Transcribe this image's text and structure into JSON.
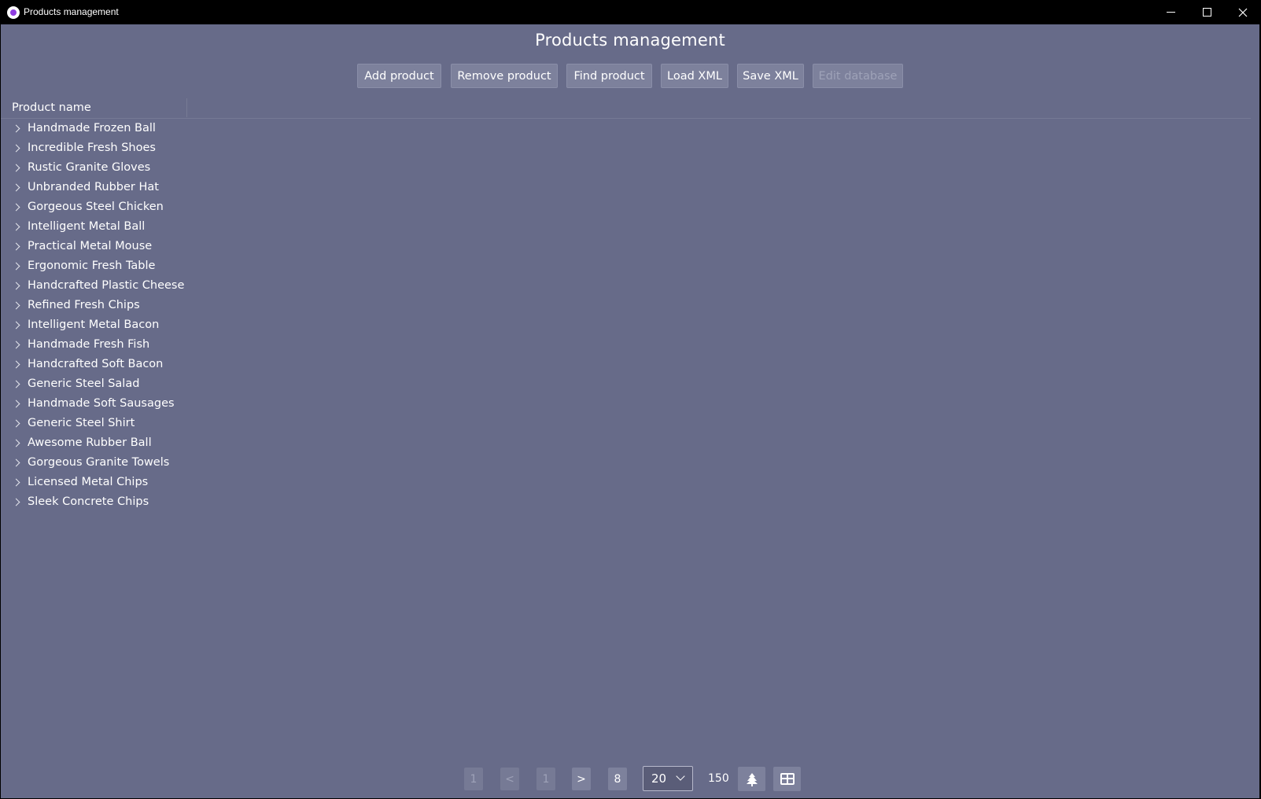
{
  "window": {
    "title": "Products management",
    "controls": [
      "minimize-icon",
      "maximize-icon",
      "close-icon"
    ]
  },
  "page": {
    "title": "Products management"
  },
  "toolbar": {
    "add": "Add product",
    "remove": "Remove product",
    "find": "Find product",
    "load": "Load XML",
    "save": "Save XML",
    "edit": "Edit database"
  },
  "grid": {
    "column_header": "Product name",
    "rows": [
      "Handmade Frozen Ball",
      "Incredible Fresh Shoes",
      "Rustic Granite Gloves",
      "Unbranded Rubber Hat",
      "Gorgeous Steel Chicken",
      "Intelligent Metal Ball",
      "Practical Metal Mouse",
      "Ergonomic Fresh Table",
      "Handcrafted Plastic Cheese",
      "Refined Fresh Chips",
      "Intelligent Metal Bacon",
      "Handmade Fresh Fish",
      "Handcrafted Soft Bacon",
      "Generic Steel Salad",
      "Handmade Soft Sausages",
      "Generic Steel Shirt",
      "Awesome Rubber Ball",
      "Gorgeous Granite Towels",
      "Licensed Metal Chips",
      "Sleek Concrete Chips"
    ]
  },
  "pager": {
    "first": "1",
    "prev": "<",
    "current": "1",
    "next": ">",
    "last": "8",
    "page_size": "20",
    "total": "150"
  },
  "colors": {
    "background": "#676b89",
    "button": "#7d819c",
    "titlebar": "#000000"
  }
}
